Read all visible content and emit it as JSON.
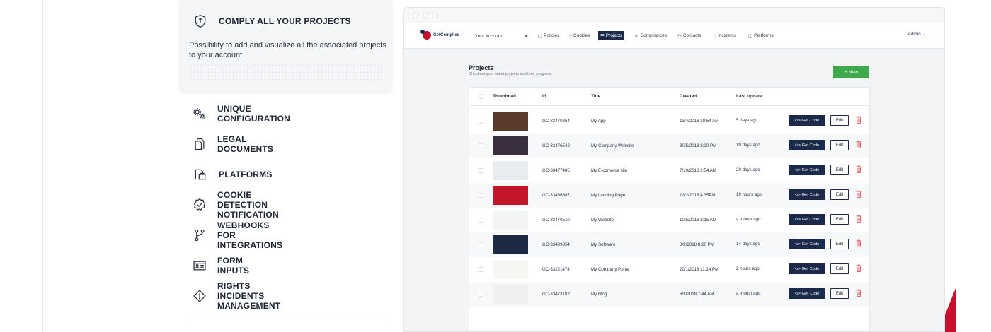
{
  "feature_panel": {
    "active": {
      "icon": "shield-icon",
      "title": "COMPLY ALL YOUR PROJECTS",
      "description": "Possibility to add and visualize all the associated projects to your account."
    },
    "items": [
      {
        "icon": "gears-icon",
        "label": "UNIQUE CONFIGURATION"
      },
      {
        "icon": "documents-icon",
        "label": "LEGAL DOCUMENTS"
      },
      {
        "icon": "platforms-icon",
        "label": "PLATFORMS"
      },
      {
        "icon": "badge-check-icon",
        "label": "COOKIE DETECTION NOTIFICATION"
      },
      {
        "icon": "git-branch-icon",
        "label": "WEBHOOKS FOR INTEGRATIONS"
      },
      {
        "icon": "id-card-icon",
        "label": "FORM INPUTS"
      },
      {
        "icon": "warning-diamond-icon",
        "label": "RIGHTS INCIDENTS MANAGEMENT"
      }
    ]
  },
  "app": {
    "logo": "GetComplied",
    "account_select": "Your Account",
    "nav": [
      {
        "icon": "file-icon",
        "label": "Policies",
        "active": false
      },
      {
        "icon": "cookie-icon",
        "label": "Cookies",
        "active": false
      },
      {
        "icon": "list-icon",
        "label": "Projects",
        "active": true
      },
      {
        "icon": "check-circle-icon",
        "label": "Compliances",
        "active": false
      },
      {
        "icon": "contacts-icon",
        "label": "Contacts",
        "active": false
      },
      {
        "icon": "chat-icon",
        "label": "Incidents",
        "active": false
      },
      {
        "icon": "platform-icon",
        "label": "Platforms",
        "active": false
      }
    ],
    "admin": "Admin ⌄",
    "page_title": "Projects",
    "page_subtitle": "Checkout your latest projects and their progress.",
    "new_button": "+ New",
    "table": {
      "headers": [
        "Thumbnail",
        "Id",
        "Title",
        "Created",
        "Last update"
      ],
      "get_code_label": "</> Get Code",
      "edit_label": "Edit",
      "rows": [
        {
          "id": "GC-33470254",
          "title": "My App",
          "created": "13/4/2018 10:54 AM",
          "updated": "5 days ago",
          "thumb_color": "#5a3a2a"
        },
        {
          "id": "GC-33476542",
          "title": "My Company Website",
          "created": "30/5/2018 3:20 PM",
          "updated": "10 days ago",
          "thumb_color": "#3a2f3f"
        },
        {
          "id": "GC-33477485",
          "title": "My E-comerce site",
          "created": "7/10/2018 2:54 AM",
          "updated": "20 days ago",
          "thumb_color": "#e9ecef"
        },
        {
          "id": "GC-33466587",
          "title": "My Landing Page",
          "created": "12/2/2018 4:35PM",
          "updated": "19 hours ago",
          "thumb_color": "#c4162a"
        },
        {
          "id": "GC-33470510",
          "title": "My Website",
          "created": "10/5/2018 3:15 AM",
          "updated": "a month ago",
          "thumb_color": "#f2f4f6"
        },
        {
          "id": "GC-33499854",
          "title": "My Software",
          "created": "3/9/2018 8:20 PM",
          "updated": "14 days ago",
          "thumb_color": "#1d2a44"
        },
        {
          "id": "GC-33221474",
          "title": "My Company Portal",
          "created": "20/1/2018 11:14 PM",
          "updated": "2 hours ago",
          "thumb_color": "#f6f7f2"
        },
        {
          "id": "GC-33473182",
          "title": "My Blog",
          "created": "6/3/2018 7:44 AM",
          "updated": "a month ago",
          "thumb_color": "#eef0f2"
        }
      ]
    }
  },
  "colors": {
    "brand_red": "#c8102e",
    "navy": "#1b2a4a",
    "green": "#3eaa4b"
  }
}
